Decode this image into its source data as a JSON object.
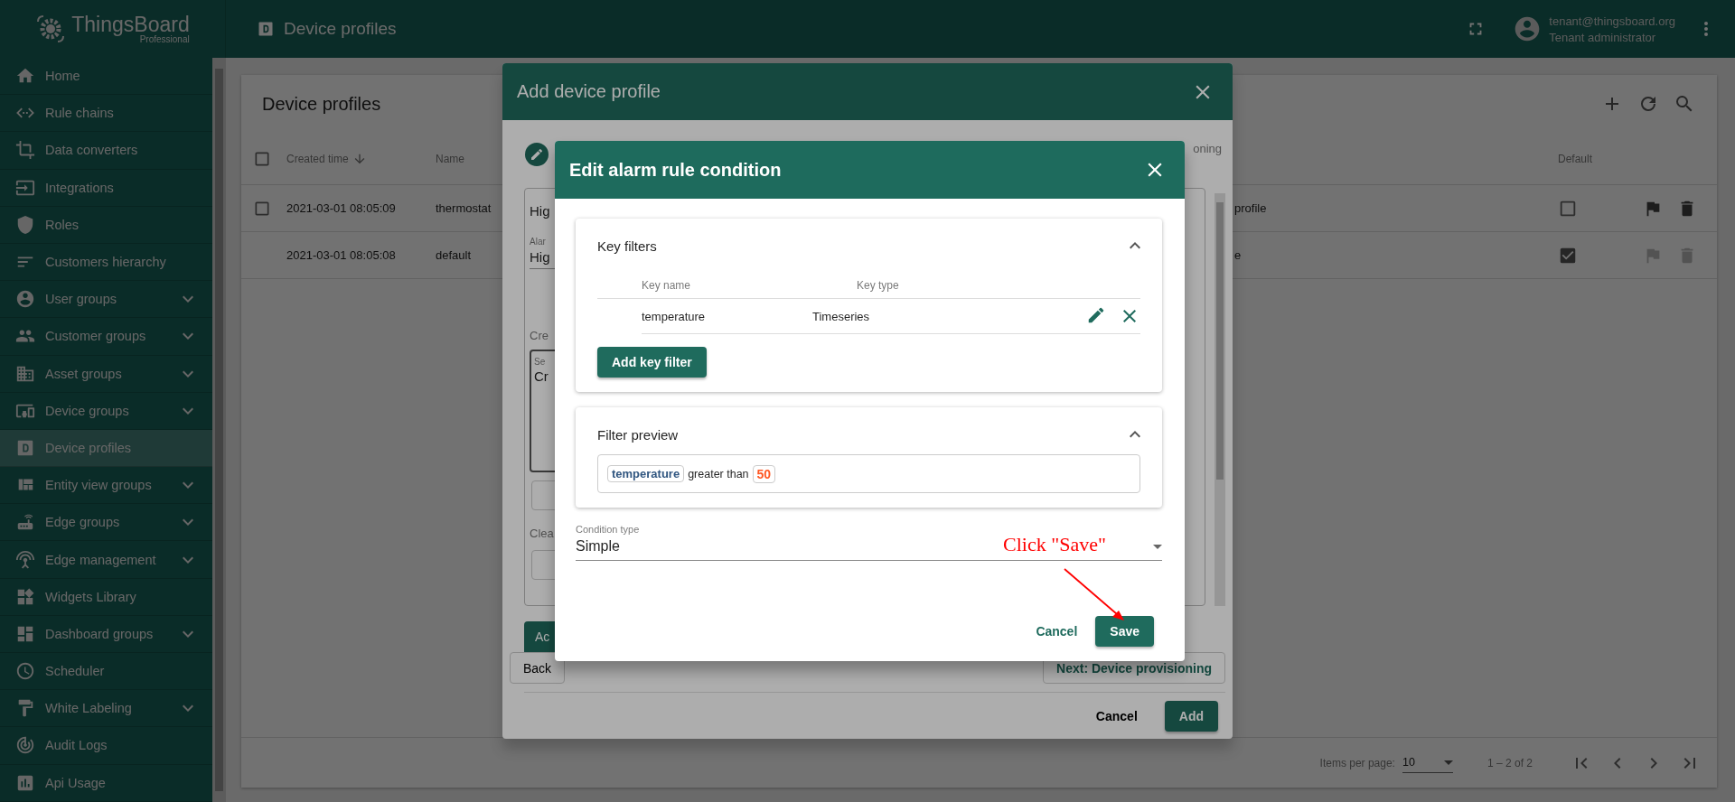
{
  "brand": {
    "name": "ThingsBoard",
    "edition": "Professional"
  },
  "header": {
    "title": "Device profiles",
    "user_email": "tenant@thingsboard.org",
    "user_role": "Tenant administrator"
  },
  "sidebar": {
    "items": [
      {
        "label": "Home",
        "expandable": false,
        "selected": false
      },
      {
        "label": "Rule chains",
        "expandable": false,
        "selected": false
      },
      {
        "label": "Data converters",
        "expandable": false,
        "selected": false
      },
      {
        "label": "Integrations",
        "expandable": false,
        "selected": false
      },
      {
        "label": "Roles",
        "expandable": false,
        "selected": false
      },
      {
        "label": "Customers hierarchy",
        "expandable": false,
        "selected": false
      },
      {
        "label": "User groups",
        "expandable": true,
        "selected": false
      },
      {
        "label": "Customer groups",
        "expandable": true,
        "selected": false
      },
      {
        "label": "Asset groups",
        "expandable": true,
        "selected": false
      },
      {
        "label": "Device groups",
        "expandable": true,
        "selected": false
      },
      {
        "label": "Device profiles",
        "expandable": false,
        "selected": true
      },
      {
        "label": "Entity view groups",
        "expandable": true,
        "selected": false
      },
      {
        "label": "Edge groups",
        "expandable": true,
        "selected": false
      },
      {
        "label": "Edge management",
        "expandable": true,
        "selected": false
      },
      {
        "label": "Widgets Library",
        "expandable": false,
        "selected": false
      },
      {
        "label": "Dashboard groups",
        "expandable": true,
        "selected": false
      },
      {
        "label": "Scheduler",
        "expandable": false,
        "selected": false
      },
      {
        "label": "White Labeling",
        "expandable": true,
        "selected": false
      },
      {
        "label": "Audit Logs",
        "expandable": false,
        "selected": false
      },
      {
        "label": "Api Usage",
        "expandable": false,
        "selected": false
      }
    ]
  },
  "page": {
    "title": "Device profiles",
    "table": {
      "all_checked": false,
      "columns": [
        {
          "label": "Created time",
          "sorted": true
        },
        {
          "label": "Name",
          "sorted": false
        },
        {
          "label": "Default",
          "sorted": false
        }
      ],
      "rows": [
        {
          "created_time": "2021-03-01 08:05:09",
          "name": "thermostat",
          "column_3": "profile",
          "selectable": true,
          "checked": false,
          "default": false,
          "actions_disabled": false
        },
        {
          "created_time": "2021-03-01 08:05:08",
          "name": "default",
          "column_3": "e",
          "selectable": false,
          "default": true,
          "actions_disabled": true
        }
      ]
    },
    "paginator": {
      "label": "Items per page:",
      "page_size": "10",
      "range": "1 – 2 of 2"
    }
  },
  "add_profile_dialog": {
    "title": "Add device profile",
    "step_label": "oning",
    "form": {
      "alarm_type": "Hig",
      "field_label": "Alar",
      "field_value": "Hig",
      "conditions_label": "Cre",
      "severity_label": "Se",
      "severity_value": "Cr",
      "clear_label": "Clea"
    },
    "add_rule_button": "Ac",
    "back_button": "Back",
    "next_button": "Next: Device provisioning",
    "cancel_button": "Cancel",
    "add_button": "Add"
  },
  "condition_dialog": {
    "title": "Edit alarm rule condition",
    "key_filters": {
      "title": "Key filters",
      "expanded": true,
      "columns": [
        "Key name",
        "Key type"
      ],
      "rows": [
        {
          "key_name": "temperature",
          "key_type": "Timeseries"
        }
      ],
      "add_button": "Add key filter"
    },
    "filter_preview": {
      "title": "Filter preview",
      "expanded": true,
      "key": "temperature",
      "operation": "greater than",
      "value": "50"
    },
    "condition_type": {
      "label": "Condition type",
      "value": "Simple"
    },
    "cancel_button": "Cancel",
    "save_button": "Save"
  },
  "annotation": {
    "text": "Click \"Save\""
  }
}
